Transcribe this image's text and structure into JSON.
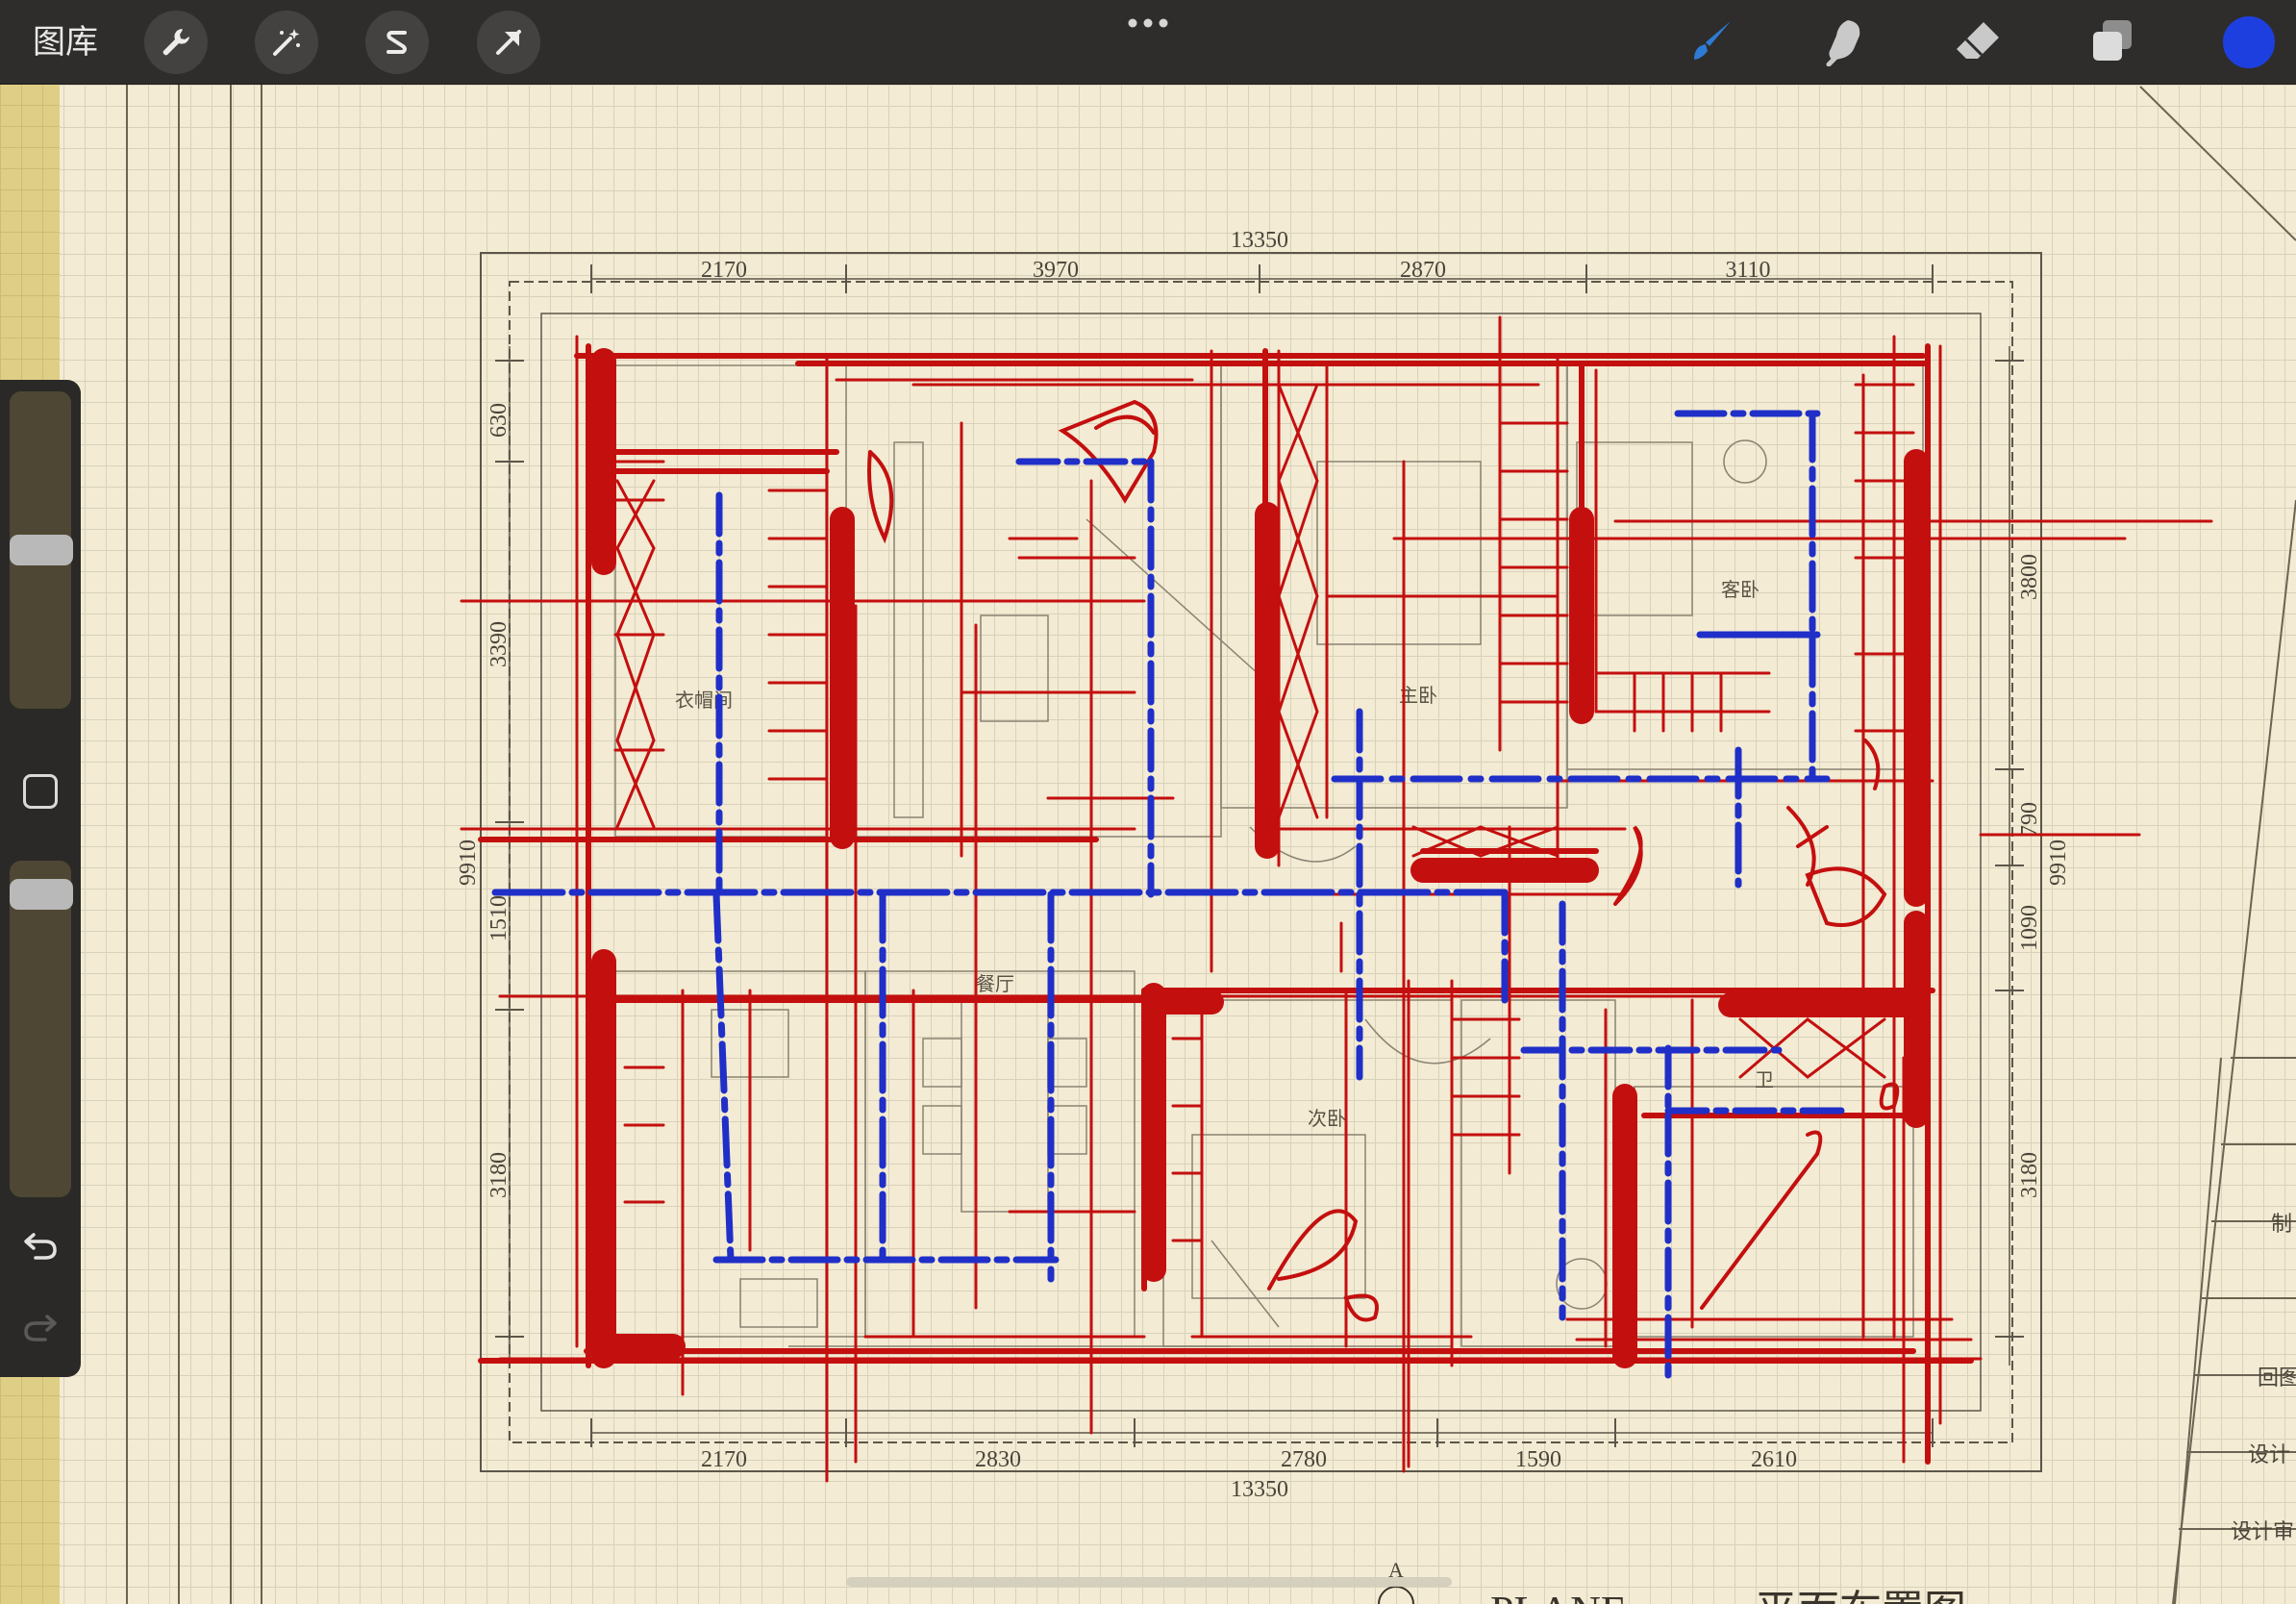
{
  "app": {
    "gallery_label": "图库",
    "more_icon": "ellipsis-icon",
    "brush_color": "#1e3fe0",
    "accent_color": "#2e7bd6"
  },
  "toolbar": {
    "left_tools": [
      {
        "name": "actions",
        "icon": "wrench-icon"
      },
      {
        "name": "adjustments",
        "icon": "magic-wand-icon"
      },
      {
        "name": "selection",
        "icon": "selection-s-icon"
      },
      {
        "name": "transform",
        "icon": "arrow-cursor-icon"
      }
    ],
    "right_tools": [
      {
        "name": "brush",
        "icon": "paintbrush-icon",
        "active": true
      },
      {
        "name": "smudge",
        "icon": "smudge-finger-icon"
      },
      {
        "name": "eraser",
        "icon": "eraser-icon"
      },
      {
        "name": "layers",
        "icon": "layers-icon"
      },
      {
        "name": "color",
        "icon": "color-swatch-icon",
        "value": "#1e3fe0"
      }
    ]
  },
  "sidebar": {
    "brush_size_level": 0.5,
    "opacity_level": 0.94,
    "modify_icon": "square-icon",
    "undo_icon": "undo-arrow-icon",
    "redo_icon": "redo-arrow-icon"
  },
  "drawing": {
    "top_total": "13350",
    "top_segments": [
      "2170",
      "3970",
      "2870",
      "3110"
    ],
    "bottom_total": "13350",
    "bottom_segments": [
      "2170",
      "2830",
      "2780",
      "1590",
      "2610"
    ],
    "left_segments": [
      "630",
      "3390",
      "1510",
      "3180"
    ],
    "left_total": "9910",
    "right_segments": [
      "3800",
      "790",
      "1090",
      "3180"
    ],
    "right_total": "9910",
    "room_labels": [
      "衣帽间",
      "主卧",
      "次卧",
      "餐厅",
      "客卧",
      "卫"
    ],
    "section_marker": "A",
    "plan_label_en": "PLANE",
    "plan_title": "平面布置图",
    "title_block_rows": [
      "制",
      "回图",
      "设计",
      "设计审"
    ]
  },
  "colors": {
    "paper": "#f3ebd3",
    "grid": "#d9d2bb",
    "red_ink": "#c40f0f",
    "blue_ink": "#1f2fc8",
    "toolbar": "#2e2d2b"
  }
}
